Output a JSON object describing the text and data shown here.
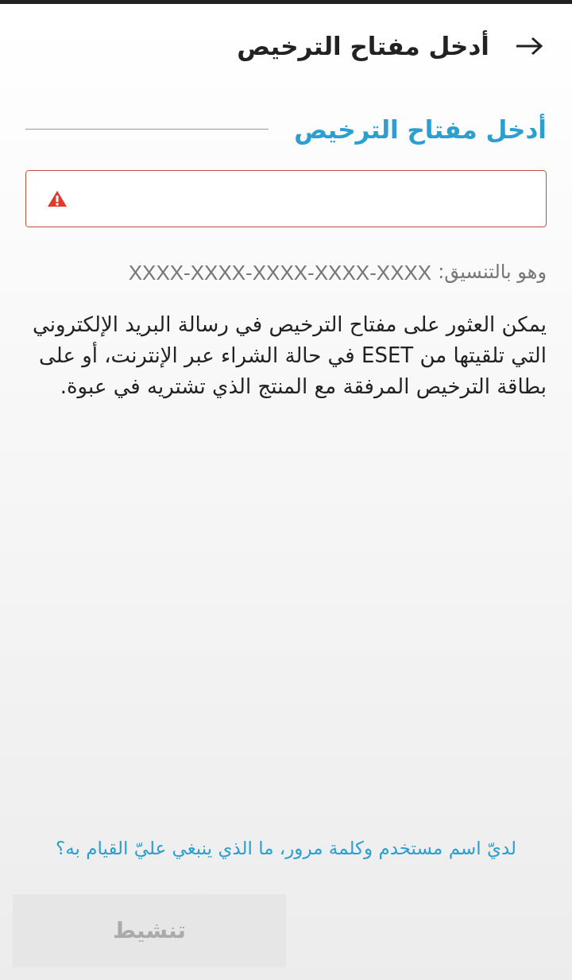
{
  "app_bar": {
    "title": "أدخل مفتاح الترخيص"
  },
  "section": {
    "title": "أدخل مفتاح الترخيص"
  },
  "license_field": {
    "error": true
  },
  "format_hint": {
    "label": "وهو بالتنسيق:",
    "format": "XXXX-XXXX-XXXX-XXXX-XXXX"
  },
  "description": "يمكن العثور على مفتاح الترخيص في رسالة البريد الإلكتروني التي تلقيتها من ESET في حالة الشراء عبر الإنترنت، أو على بطاقة الترخيص المرفقة مع المنتج الذي تشتريه في عبوة.",
  "help_link": "لديّ اسم مستخدم وكلمة مرور، ما الذي ينبغي عليّ القيام به؟",
  "activate_button": {
    "label": "تنشيط",
    "disabled": true
  }
}
